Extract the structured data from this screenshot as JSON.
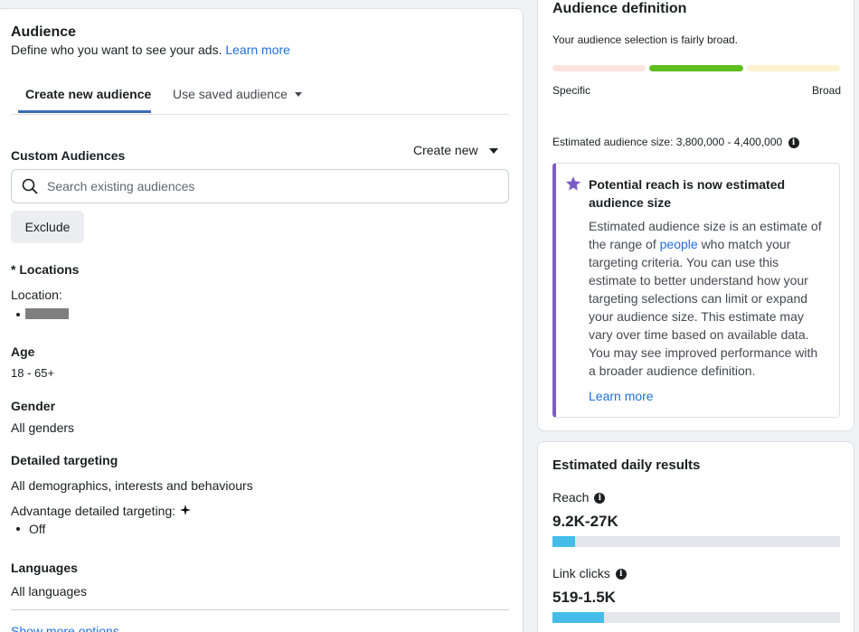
{
  "audience": {
    "title": "Audience",
    "description": "Define who you want to see your ads.",
    "learn_more": "Learn more",
    "tabs": [
      {
        "label": "Create new audience",
        "active": true
      },
      {
        "label": "Use saved audience",
        "active": false
      }
    ],
    "custom_audiences": {
      "label": "Custom Audiences",
      "create_new": "Create new",
      "search_placeholder": "Search existing audiences",
      "exclude": "Exclude"
    },
    "locations": {
      "label": "* Locations",
      "sublabel": "Location:"
    },
    "age": {
      "label": "Age",
      "value": "18 - 65+"
    },
    "gender": {
      "label": "Gender",
      "value": "All genders"
    },
    "detailed_targeting": {
      "label": "Detailed targeting",
      "value": "All demographics, interests and behaviours",
      "advantage_label": "Advantage detailed targeting:",
      "advantage_value": "Off"
    },
    "languages": {
      "label": "Languages",
      "value": "All languages"
    },
    "show_more": "Show more options"
  },
  "definition": {
    "title": "Audience definition",
    "status": "Your audience selection is fairly broad.",
    "scale_min": "Specific",
    "scale_max": "Broad",
    "meter_position": "middle",
    "estimated_size_label": "Estimated audience size: 3,800,000 - 4,400,000",
    "notice": {
      "title": "Potential reach is now estimated audience size",
      "body_before": "Estimated audience size is an estimate of the range of",
      "body_link": "people",
      "body_after": "who match your targeting criteria. You can use this estimate to better understand how your targeting selections can limit or expand your audience size. This estimate may vary over time based on available data. You may see improved performance with a broader audience definition.",
      "learn_more": "Learn more"
    }
  },
  "daily_results": {
    "title": "Estimated daily results",
    "metrics": [
      {
        "label": "Reach",
        "value": "9.2K-27K",
        "fill_fraction": 0.08
      },
      {
        "label": "Link clicks",
        "value": "519-1.5K",
        "fill_fraction": 0.18
      }
    ]
  },
  "colors": {
    "accent_blue": "#216fdb",
    "meter_active": "#5fbd1d",
    "meter_specific": "#fde3dd",
    "meter_broad": "#fdf1d0",
    "notice_border": "#7c5cc4",
    "bar_fill": "#45bde8"
  },
  "icons": [
    "search-icon",
    "caret-down-icon",
    "info-icon",
    "star-icon",
    "sparkle-icon"
  ]
}
